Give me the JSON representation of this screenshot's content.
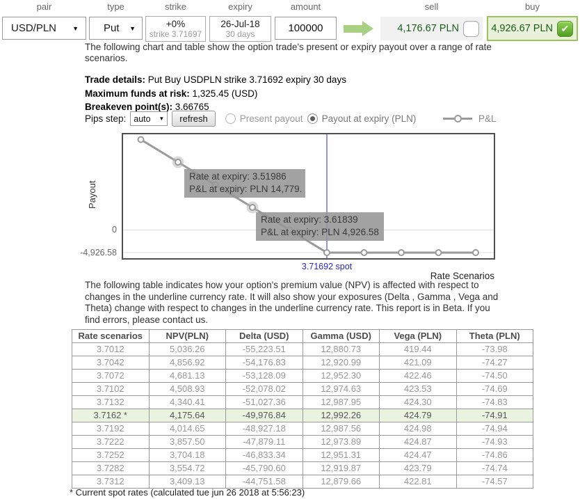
{
  "controls": {
    "pair_label": "pair",
    "pair_value": "USD/PLN",
    "type_label": "type",
    "type_value": "Put",
    "strike_label": "strike",
    "strike_pct": "+0%",
    "strike_sub": "strike 3.71697",
    "expiry_label": "expiry",
    "expiry_date": "26-Jul-18",
    "expiry_sub": "30 days",
    "amount_label": "amount",
    "amount_value": "100000",
    "sell_label": "sell",
    "sell_price": "4,176.67 PLN",
    "buy_label": "buy",
    "buy_price": "4,926.67 PLN"
  },
  "intro_text": "The following chart and table show the option trade's present or expiry payout over a range of rate scenarios.",
  "details": {
    "trade_label": "Trade details:",
    "trade_value": " Put Buy USDPLN strike 3.71692 expiry 30 days",
    "risk_label": "Maximum funds at risk:",
    "risk_value": " 1,325.45 (USD)",
    "breakeven_label": "Breakeven point(s):",
    "breakeven_value": " 3.66765"
  },
  "pips": {
    "label": "Pips step:",
    "step_value": "auto",
    "refresh_label": "refresh",
    "radio_present": "Present payout",
    "radio_expiry": "Payout at expiry (PLN)"
  },
  "chart_data": {
    "type": "line",
    "xlabel": "Rate Scenarios",
    "ylabel": "Payout",
    "legend": "P&L",
    "x": [
      3.47059,
      3.51986,
      3.56912,
      3.61839,
      3.66765,
      3.71692,
      3.76619,
      3.81545,
      3.86472,
      3.91398
    ],
    "y": [
      19706,
      14779,
      9853,
      4927,
      0,
      -4927,
      -4927,
      -4927,
      -4927,
      -4927
    ],
    "yticks": [
      "0",
      "-4,926.58"
    ],
    "ytick_values": [
      0,
      -4926.58
    ],
    "spot": {
      "rate": 3.71692,
      "label": "3.71692 spot"
    },
    "highlighted_points": [
      1,
      3
    ],
    "tooltips": [
      {
        "point_index": 1,
        "line1": "Rate at expiry: 3.51986",
        "line2": "P&L at expiry: PLN 14,779."
      },
      {
        "point_index": 3,
        "line1": "Rate at expiry: 3.61839",
        "line2": "P&L at expiry: PLN 4,926.58"
      }
    ],
    "colors": {
      "series": "#9a9a9a",
      "spot_line": "#2727cd",
      "grid": "#dddddd"
    }
  },
  "table_intro": "The following table indicates how your option's premium value (NPV) is affected with respect to changes in the underline currency rate. It will also show your exposures (Delta , Gamma , Vega and Theta) change with respect to changes in the underline currency rate. This report is in Beta. If you find errors, please contact us.",
  "table": {
    "headers": [
      "Rate scenarios",
      "NPV(PLN)",
      "Delta (USD)",
      "Gamma (USD)",
      "Vega (PLN)",
      "Theta (PLN)"
    ],
    "highlight_row": 5,
    "rows": [
      [
        "3.7012",
        "5,036.26",
        "-55,223.51",
        "12,880.73",
        "419.44",
        "-73.98"
      ],
      [
        "3.7042",
        "4,856.92",
        "-54,176.83",
        "12,920.99",
        "421.09",
        "-74.27"
      ],
      [
        "3.7072",
        "4,681.13",
        "-53,128.09",
        "12,952.30",
        "422.46",
        "-74.50"
      ],
      [
        "3.7102",
        "4,508.93",
        "-52,078.02",
        "12,974.63",
        "423.53",
        "-74.69"
      ],
      [
        "3.7132",
        "4,340.41",
        "-51,027.36",
        "12,987.95",
        "424.30",
        "-74.83"
      ],
      [
        "3.7162 *",
        "4,175.64",
        "-49,976.84",
        "12,992.26",
        "424.79",
        "-74.91"
      ],
      [
        "3.7192",
        "4,014.65",
        "-48,927.18",
        "12,987.56",
        "424.98",
        "-74.94"
      ],
      [
        "3.7222",
        "3,857.50",
        "-47,879.11",
        "12,973.89",
        "424.87",
        "-74.93"
      ],
      [
        "3.7252",
        "3,704.18",
        "-46,833.34",
        "12,951.31",
        "424.47",
        "-74.86"
      ],
      [
        "3.7282",
        "3,554.72",
        "-45,790.60",
        "12,919.87",
        "423.79",
        "-74.74"
      ],
      [
        "3.7312",
        "3,409.13",
        "-44,751.58",
        "12,879.66",
        "422.81",
        "-74.57"
      ]
    ]
  },
  "footnote": "* Current spot rates (calculated tue jun 26 2018 at 5:56:23)"
}
